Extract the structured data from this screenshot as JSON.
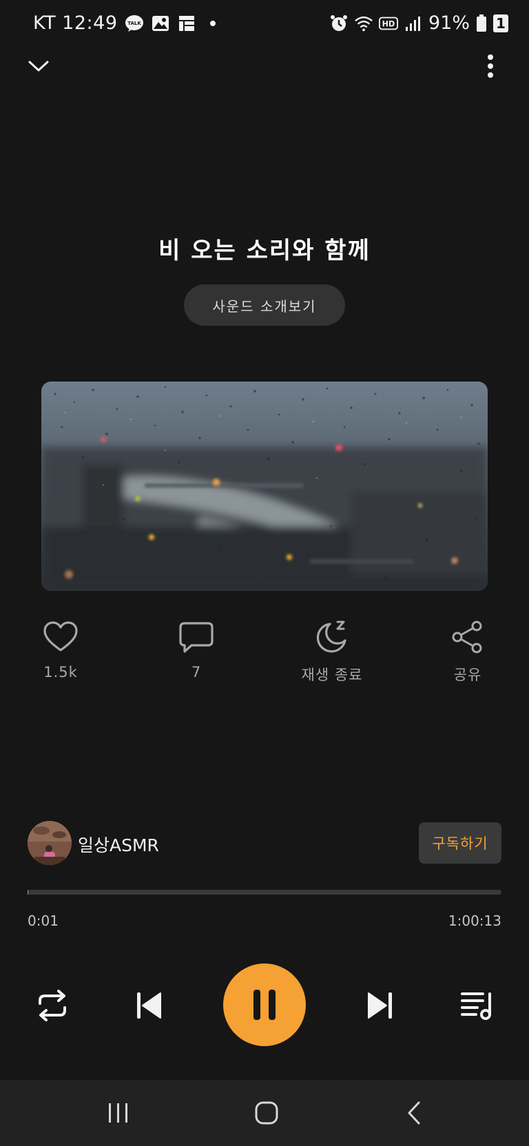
{
  "status_bar": {
    "carrier_time": "KT 12:49",
    "battery": "91%",
    "sim_badge": "1",
    "left_icons": [
      "talk-icon",
      "gallery-icon",
      "grid-icon",
      "dot-icon"
    ],
    "right_icons": [
      "alarm-icon",
      "wifi-icon",
      "hd-icon",
      "signal-icon",
      "battery-icon"
    ]
  },
  "player": {
    "title": "비 오는 소리와 함께",
    "intro_button": "사운드 소개보기"
  },
  "actions": {
    "like_count": "1.5k",
    "comment_count": "7",
    "sleep_label": "재생 종료",
    "share_label": "공유"
  },
  "channel": {
    "name": "일상ASMR",
    "subscribe_label": "구독하기"
  },
  "progress": {
    "elapsed": "0:01",
    "total": "1:00:13",
    "fraction": 0.0003
  },
  "colors": {
    "accent": "#f6a133",
    "background": "#161616"
  }
}
